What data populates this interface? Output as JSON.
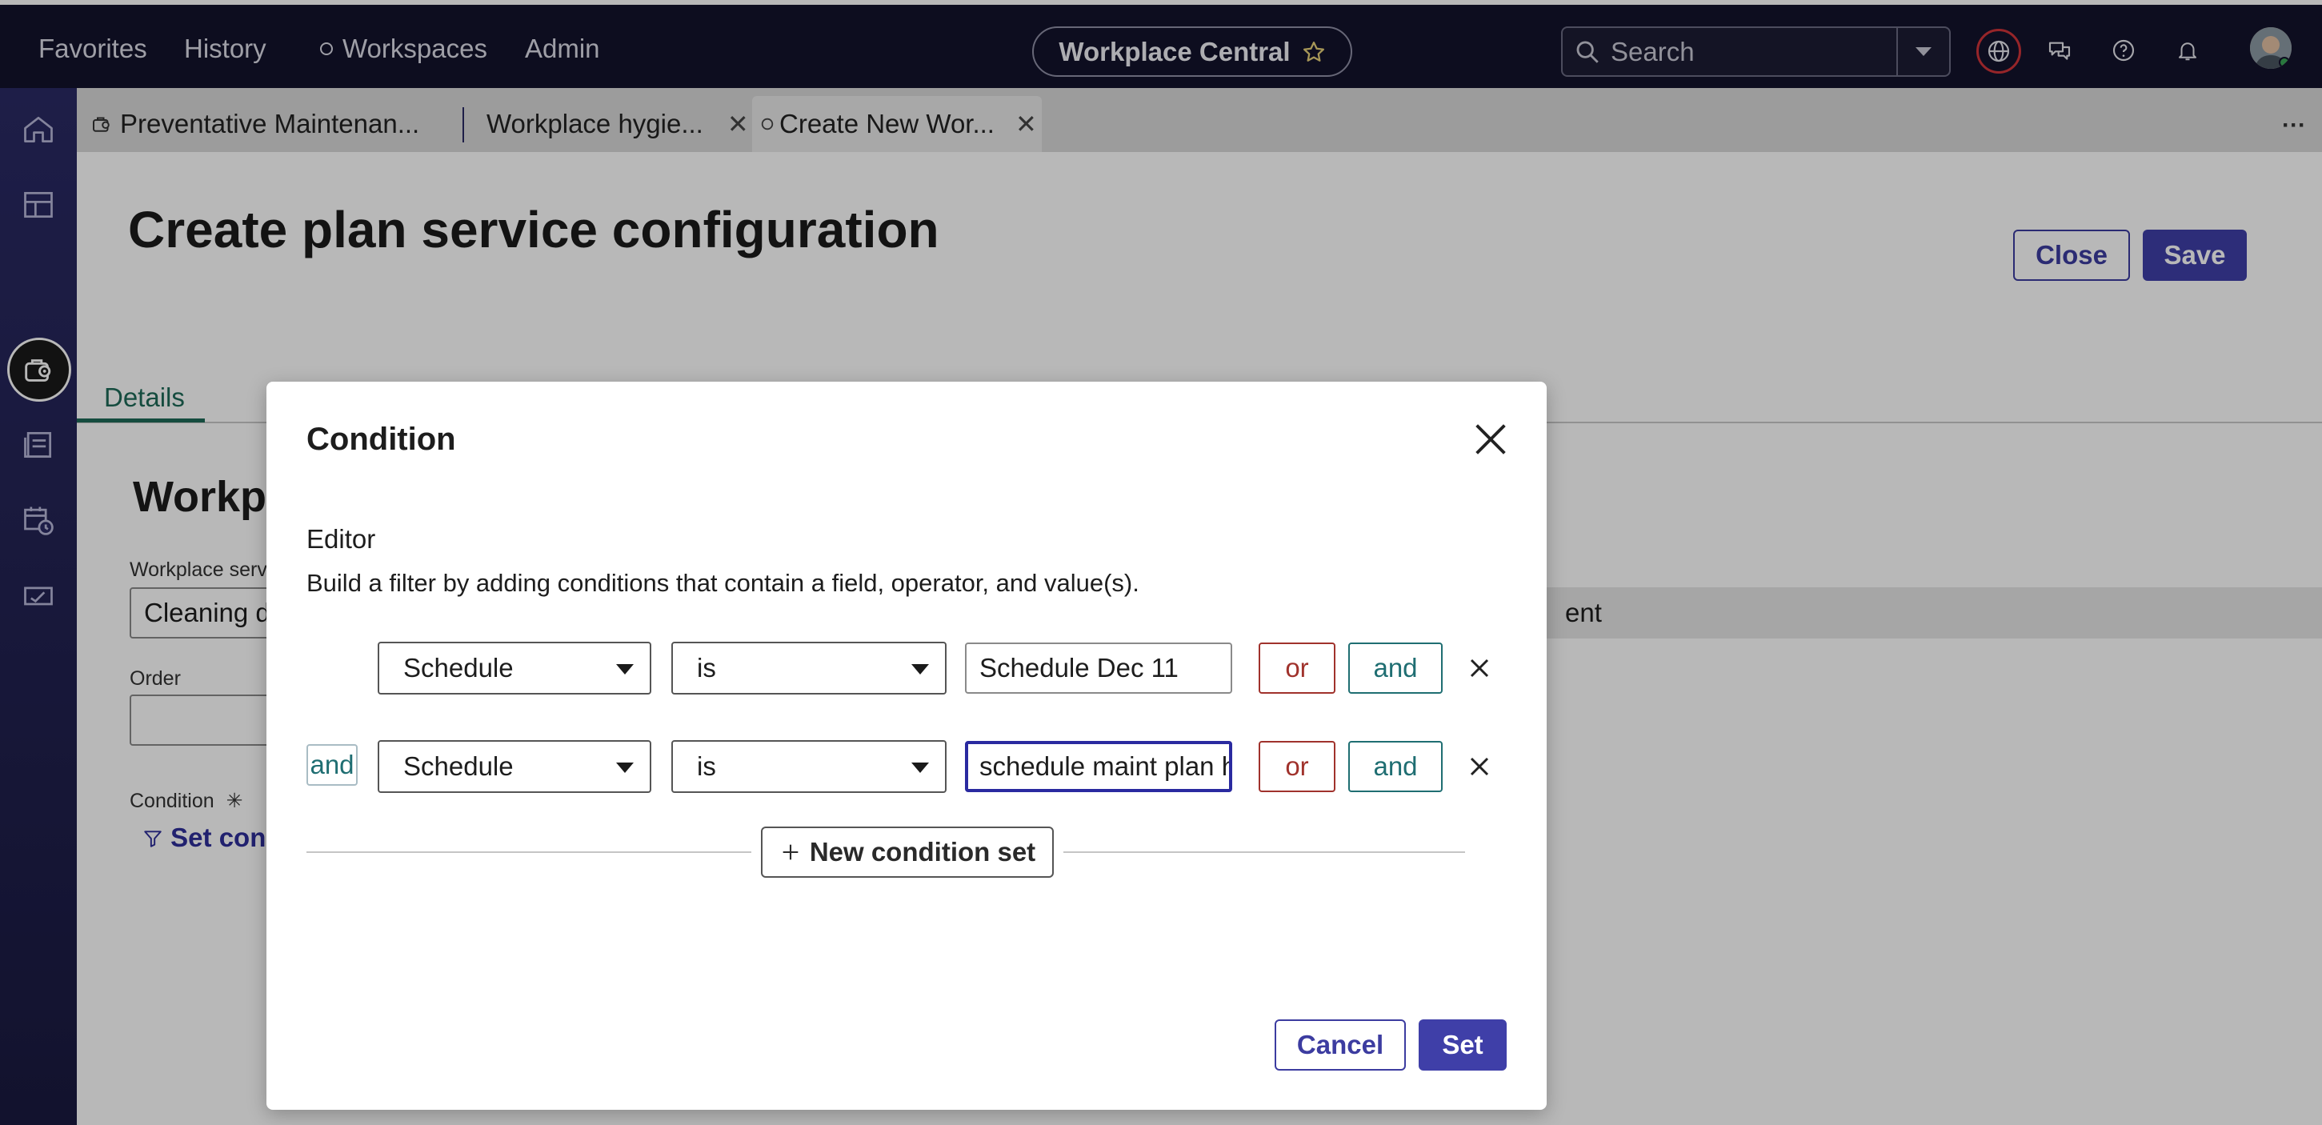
{
  "nav": {
    "favorites": "Favorites",
    "history": "History",
    "workspaces": "Workspaces",
    "admin": "Admin",
    "app_name": "Workplace Central",
    "search_placeholder": "Search"
  },
  "tabs": [
    {
      "label": "Preventative Maintenan..."
    },
    {
      "label": "Workplace hygie..."
    },
    {
      "label": "Create New Wor..."
    }
  ],
  "page": {
    "title": "Create plan service configuration",
    "close_label": "Close",
    "save_label": "Save",
    "details_tab": "Details",
    "section_title": "Workpla",
    "field1_label": "Workplace servi",
    "field1_value": "Cleaning de",
    "readonly_value": "ent",
    "order_label": "Order",
    "condition_label": "Condition",
    "set_condition_link": "Set cond"
  },
  "dialog": {
    "title": "Condition",
    "section": "Editor",
    "description": "Build a filter by adding conditions that contain a field, operator, and value(s).",
    "rows": [
      {
        "join": "",
        "field": "Schedule",
        "operator": "is",
        "value": "Schedule Dec 11",
        "or_label": "or",
        "and_label": "and"
      },
      {
        "join": "and",
        "field": "Schedule",
        "operator": "is",
        "value": "schedule maint plan h",
        "or_label": "or",
        "and_label": "and"
      }
    ],
    "new_condition_set": "New condition set",
    "cancel_label": "Cancel",
    "set_label": "Set"
  },
  "colors": {
    "nav_bg": "#13132b",
    "rail_bg": "#2a2a64",
    "primary": "#3f3fa8",
    "or_red": "#a0322c",
    "and_teal": "#1f6e72",
    "tab_green": "#1e6a58"
  }
}
